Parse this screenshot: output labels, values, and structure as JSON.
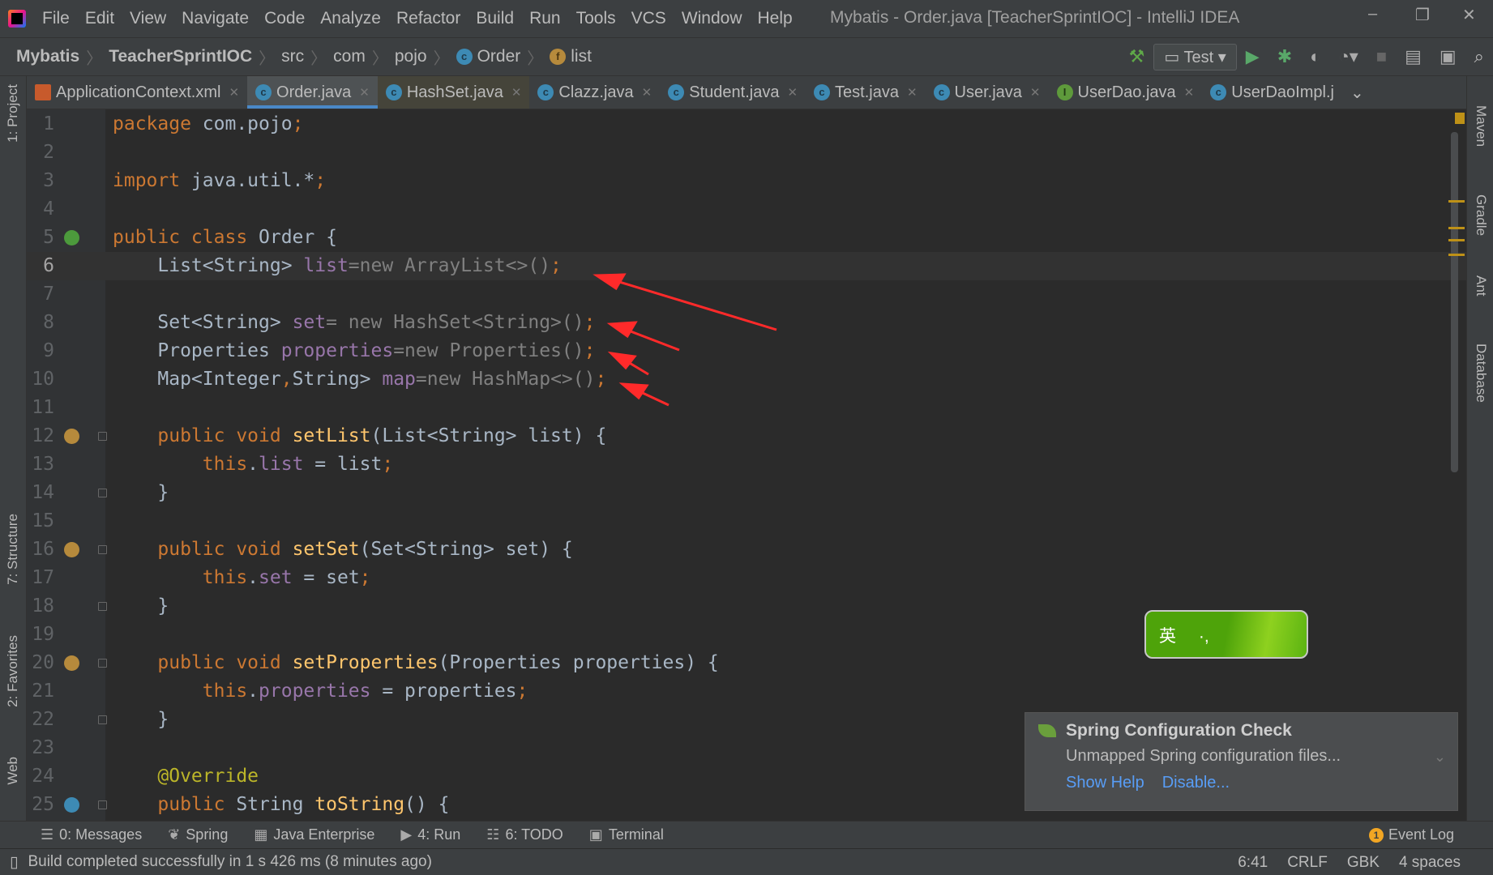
{
  "window": {
    "title": "Mybatis - Order.java [TeacherSprintIOC] - IntelliJ IDEA",
    "minimize": "–",
    "restore": "❐",
    "close": "✕"
  },
  "menu": [
    "File",
    "Edit",
    "View",
    "Navigate",
    "Code",
    "Analyze",
    "Refactor",
    "Build",
    "Run",
    "Tools",
    "VCS",
    "Window",
    "Help"
  ],
  "breadcrumb": [
    {
      "label": "Mybatis",
      "bold": true
    },
    {
      "label": "TeacherSprintIOC",
      "bold": true
    },
    {
      "label": "src"
    },
    {
      "label": "com"
    },
    {
      "label": "pojo"
    },
    {
      "label": "Order",
      "icon": "class-icon"
    },
    {
      "label": "list",
      "icon": "field-icon"
    }
  ],
  "toolbar": {
    "run_config": "Test",
    "icons": [
      "build-hammer-icon",
      "run-icon",
      "debug-icon",
      "coverage-icon",
      "profile-icon",
      "stop-icon",
      "project-structure-icon",
      "presentation-icon",
      "search-icon"
    ]
  },
  "tabs": [
    {
      "label": "ApplicationContext.xml",
      "icon": "xml-icon"
    },
    {
      "label": "Order.java",
      "icon": "class-icon",
      "active": true
    },
    {
      "label": "HashSet.java",
      "icon": "class-icon",
      "hover": true
    },
    {
      "label": "Clazz.java",
      "icon": "class-icon"
    },
    {
      "label": "Student.java",
      "icon": "class-icon"
    },
    {
      "label": "Test.java",
      "icon": "class-icon"
    },
    {
      "label": "User.java",
      "icon": "class-icon"
    },
    {
      "label": "UserDao.java",
      "icon": "interface-icon"
    },
    {
      "label": "UserDaoImpl.j",
      "icon": "class-icon"
    }
  ],
  "left_tools": [
    "1: Project",
    "7: Structure",
    "2: Favorites",
    "Web"
  ],
  "right_tools": [
    "Maven",
    "Gradle",
    "Ant",
    "Database"
  ],
  "editor": {
    "current_line": 6,
    "lines": [
      [
        [
          "package ",
          "kw"
        ],
        [
          "com.pojo",
          "df"
        ],
        [
          ";",
          "kw"
        ]
      ],
      [],
      [
        [
          "import ",
          "kw"
        ],
        [
          "java.util.*",
          "df"
        ],
        [
          ";",
          "kw"
        ]
      ],
      [],
      [
        [
          "public class ",
          "kw"
        ],
        [
          "Order {",
          "df"
        ]
      ],
      [
        [
          "    List<String> ",
          "df"
        ],
        [
          "list",
          "fd"
        ],
        [
          "=new ArrayList<>()",
          "gr"
        ],
        [
          ";",
          "kw"
        ]
      ],
      [],
      [
        [
          "    Set<String> ",
          "df"
        ],
        [
          "set",
          "fd"
        ],
        [
          "= new HashSet<String>()",
          "gr"
        ],
        [
          ";",
          "kw"
        ]
      ],
      [
        [
          "    Properties ",
          "df"
        ],
        [
          "properties",
          "fd"
        ],
        [
          "=new Properties()",
          "gr"
        ],
        [
          ";",
          "kw"
        ]
      ],
      [
        [
          "    Map<Integer",
          "df"
        ],
        [
          ",",
          "kw"
        ],
        [
          "String> ",
          "df"
        ],
        [
          "map",
          "fd"
        ],
        [
          "=new HashMap<>()",
          "gr"
        ],
        [
          ";",
          "kw"
        ]
      ],
      [],
      [
        [
          "    public void ",
          "kw"
        ],
        [
          "setList",
          "mt"
        ],
        [
          "(List<String> list) {",
          "df"
        ]
      ],
      [
        [
          "        this",
          "kw"
        ],
        [
          ".",
          "df"
        ],
        [
          "list",
          "fd"
        ],
        [
          " = list",
          "df"
        ],
        [
          ";",
          "kw"
        ]
      ],
      [
        [
          "    }",
          "df"
        ]
      ],
      [],
      [
        [
          "    public void ",
          "kw"
        ],
        [
          "setSet",
          "mt"
        ],
        [
          "(Set<String> set) {",
          "df"
        ]
      ],
      [
        [
          "        this",
          "kw"
        ],
        [
          ".",
          "df"
        ],
        [
          "set",
          "fd"
        ],
        [
          " = set",
          "df"
        ],
        [
          ";",
          "kw"
        ]
      ],
      [
        [
          "    }",
          "df"
        ]
      ],
      [],
      [
        [
          "    public void ",
          "kw"
        ],
        [
          "setProperties",
          "mt"
        ],
        [
          "(Properties properties) {",
          "df"
        ]
      ],
      [
        [
          "        this",
          "kw"
        ],
        [
          ".",
          "df"
        ],
        [
          "properties",
          "fd"
        ],
        [
          " = properties",
          "df"
        ],
        [
          ";",
          "kw"
        ]
      ],
      [
        [
          "    }",
          "df"
        ]
      ],
      [],
      [
        [
          "    @Override",
          "an"
        ]
      ],
      [
        [
          "    public ",
          "kw"
        ],
        [
          "String ",
          "df"
        ],
        [
          "toString",
          "mt"
        ],
        [
          "() {",
          "df"
        ]
      ]
    ]
  },
  "ime": {
    "lang": "英",
    "punct": "·,"
  },
  "notification": {
    "title": "Spring Configuration Check",
    "body": "Unmapped Spring configuration files...",
    "actions": [
      "Show Help",
      "Disable..."
    ]
  },
  "tool_windows": [
    {
      "label": "0: Messages",
      "icon": "messages-icon"
    },
    {
      "label": "Spring",
      "icon": "spring-icon"
    },
    {
      "label": "Java Enterprise",
      "icon": "java-enterprise-icon"
    },
    {
      "label": "4: Run",
      "icon": "run-icon"
    },
    {
      "label": "6: TODO",
      "icon": "todo-icon"
    },
    {
      "label": "Terminal",
      "icon": "terminal-icon"
    }
  ],
  "event_log": {
    "label": "Event Log",
    "count": "1"
  },
  "status": {
    "message": "Build completed successfully in 1 s 426 ms (8 minutes ago)",
    "position": "6:41",
    "line_sep": "CRLF",
    "encoding": "GBK",
    "indent": "4 spaces"
  },
  "colors": {
    "keyword": "#cc7832",
    "field": "#9876aa",
    "method": "#ffc66d",
    "annotation": "#bbb529",
    "accent": "#4a88c7",
    "arrow": "#ff2a2a"
  }
}
